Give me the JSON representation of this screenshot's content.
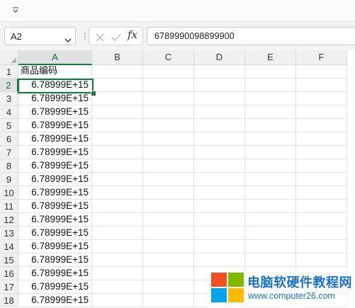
{
  "quick_access": {
    "icon": "customize-qat-icon"
  },
  "formula_bar": {
    "name_box": "A2",
    "separator": "⋮",
    "fx_label": "fx",
    "formula": "6789990098899900"
  },
  "columns": [
    "A",
    "B",
    "C",
    "D",
    "E",
    "F"
  ],
  "rows": [
    {
      "num": "1",
      "a": "商品编码"
    },
    {
      "num": "2",
      "a": "6.78999E+15"
    },
    {
      "num": "3",
      "a": "6.78999E+15"
    },
    {
      "num": "4",
      "a": "6.78999E+15"
    },
    {
      "num": "5",
      "a": "6.78999E+15"
    },
    {
      "num": "6",
      "a": "6.78999E+15"
    },
    {
      "num": "7",
      "a": "6.78999E+15"
    },
    {
      "num": "8",
      "a": "6.78999E+15"
    },
    {
      "num": "9",
      "a": "6.78999E+15"
    },
    {
      "num": "10",
      "a": "6.78999E+15"
    },
    {
      "num": "11",
      "a": "6.78999E+15"
    },
    {
      "num": "12",
      "a": "6.78999E+15"
    },
    {
      "num": "13",
      "a": "6.78999E+15"
    },
    {
      "num": "14",
      "a": "6.78999E+15"
    },
    {
      "num": "15",
      "a": "6.78999E+15"
    },
    {
      "num": "16",
      "a": "6.78999E+15"
    },
    {
      "num": "17",
      "a": "6.78999E+15"
    },
    {
      "num": "18",
      "a": "6.78999E+15"
    }
  ],
  "active": {
    "column": "A",
    "row": "2"
  },
  "watermark": {
    "title": "电脑软硬件教程网",
    "url": "www.computer26.com",
    "logo_colors": [
      "#f25022",
      "#7fba00",
      "#00a4ef",
      "#ffb900"
    ]
  },
  "colors": {
    "selection": "#107c41",
    "watermark_text": "#1a73c8"
  }
}
